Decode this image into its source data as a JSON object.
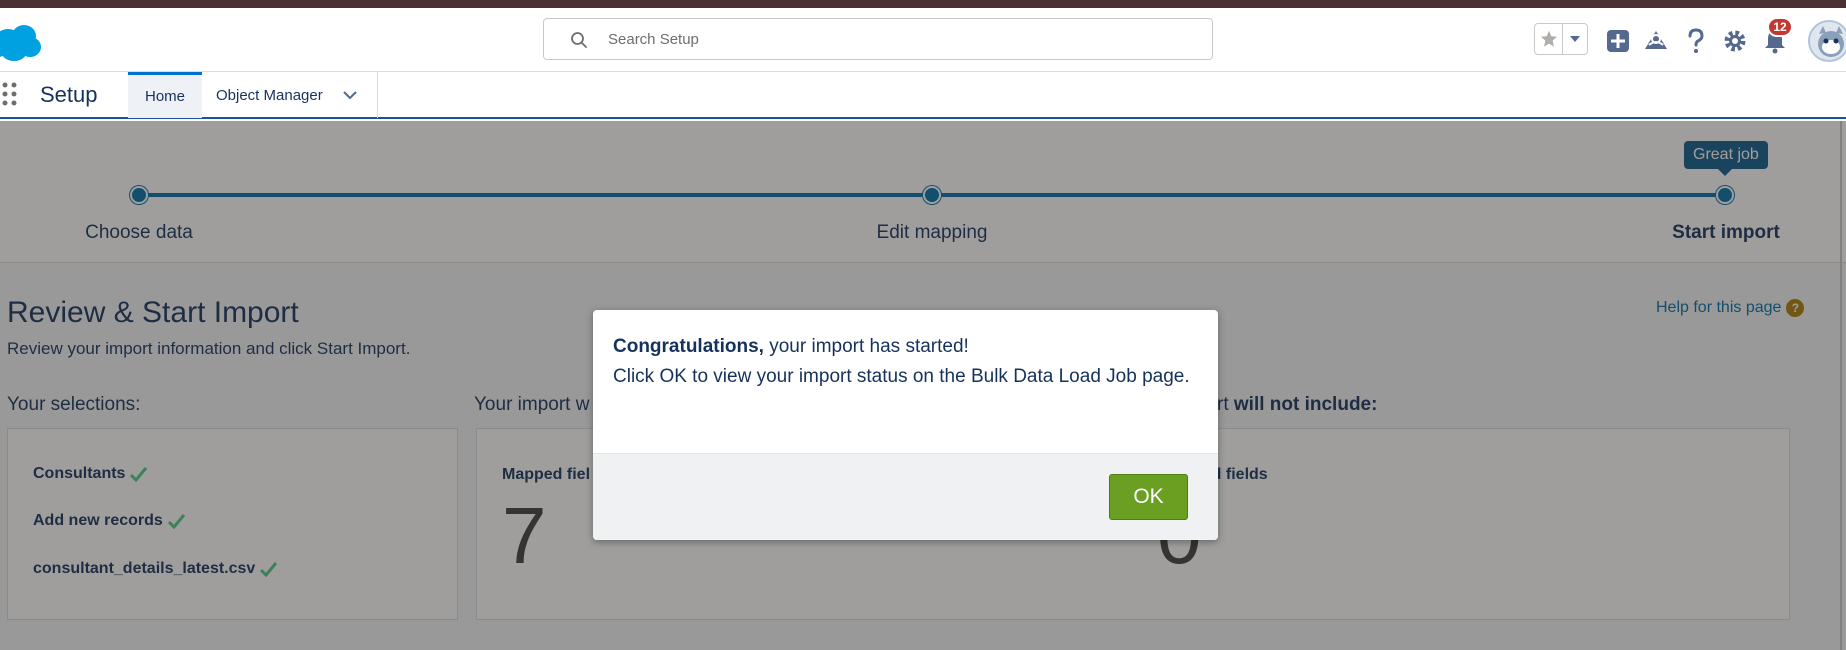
{
  "header": {
    "search": {
      "placeholder": "Search Setup",
      "value": ""
    },
    "notifications": {
      "count": "12"
    }
  },
  "context_bar": {
    "app_name": "Setup",
    "tabs": [
      {
        "label": "Home",
        "active": true
      },
      {
        "label": "Object Manager",
        "active": false
      }
    ]
  },
  "progress": {
    "steps": [
      {
        "label": "Choose data"
      },
      {
        "label": "Edit mapping"
      },
      {
        "label": "Start import",
        "active": true
      }
    ],
    "tooltip": "Great job"
  },
  "page": {
    "title": "Review & Start Import",
    "subtitle": "Review your import information and click Start Import.",
    "help_link": "Help for this page",
    "selections": {
      "heading": "Your selections:",
      "items": [
        "Consultants",
        "Add new records",
        "consultant_details_latest.csv"
      ]
    },
    "import_will": {
      "heading_visible": "Your import w",
      "stat_label": "Mapped fiel",
      "stat_value": "7"
    },
    "import_will_not": {
      "heading_prefix": "rt",
      "heading_bold": "will not include:",
      "stat_label": "ped fields",
      "stat_value": "0"
    }
  },
  "modal": {
    "bold_text": "Congratulations,",
    "line1_rest": " your import has started!",
    "line2": "Click OK to view your import status on the Bulk Data Load Job page.",
    "ok_label": "OK"
  },
  "colors": {
    "accent": "#0070a8",
    "ok_button": "#6b9f22",
    "badge": "#c23934",
    "top_strip": "#4a3033"
  },
  "icons": [
    "salesforce-cloud-icon",
    "search-icon",
    "star-icon",
    "chevron-down-icon",
    "plus-icon",
    "trailhead-icon",
    "help-icon",
    "gear-icon",
    "bell-icon",
    "app-launcher-icon",
    "check-icon"
  ]
}
